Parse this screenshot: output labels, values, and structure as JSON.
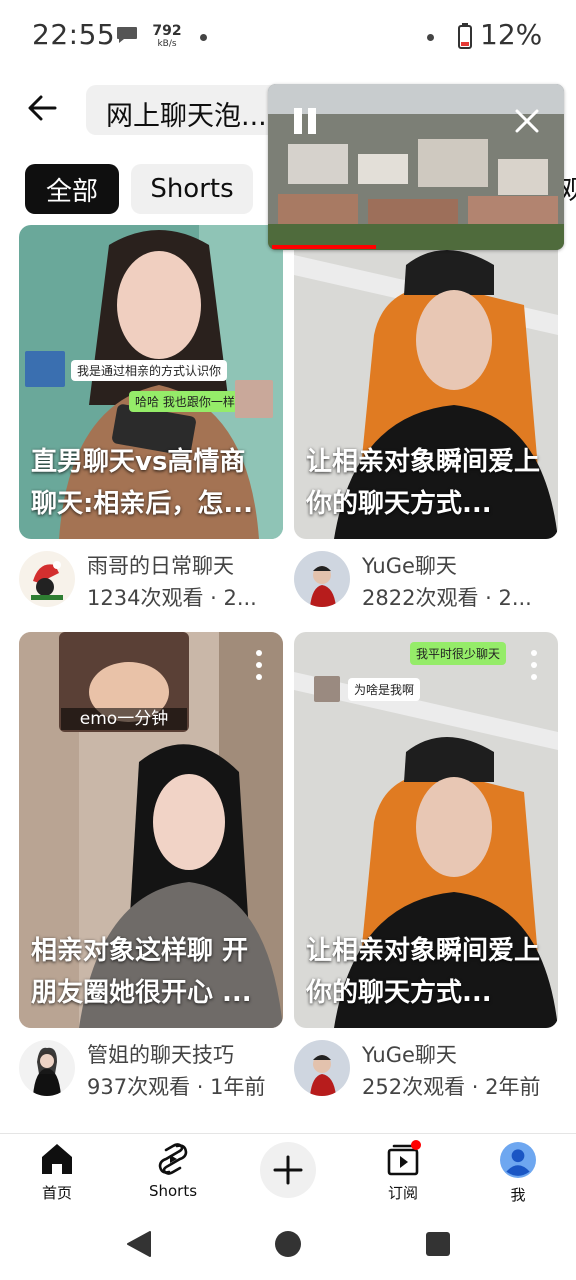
{
  "status_bar": {
    "time": "22:55",
    "net_speed_value": "792",
    "net_speed_unit": "kB/s",
    "battery_text": "12%",
    "battery_color": "#e53935"
  },
  "search": {
    "query": "网上聊天泡..."
  },
  "chips": {
    "all": "全部",
    "shorts": "Shorts",
    "edge_partial": "观"
  },
  "mini_player": {
    "progress": 0.36,
    "progress_color": "#ff0000"
  },
  "videos": [
    {
      "title": "直男聊天vs高情商聊天:相亲后，怎...",
      "overlay_chat_1": "我是通过相亲的方式认识你",
      "overlay_chat_2": "哈哈 我也跟你一样",
      "channel": "雨哥的日常聊天",
      "views": "1234次观看 · 2...",
      "avatar_icon": "santa-hat-avatar-icon"
    },
    {
      "title": "让相亲对象瞬间爱上你的聊天方式...",
      "channel": "YuGe聊天",
      "views": "2822次观看 · 2...",
      "avatar_icon": "man-avatar-icon"
    },
    {
      "title": "相亲对象这样聊 开朋友圈她很开心 ...",
      "overlay_caption": "emo一分钟",
      "channel": "管姐的聊天技巧",
      "views": "937次观看 · 1年前",
      "avatar_icon": "woman-avatar-icon"
    },
    {
      "title": "让相亲对象瞬间爱上你的聊天方式...",
      "overlay_chat_1": "我平时很少聊天",
      "overlay_chat_2": "为啥是我啊",
      "channel": "YuGe聊天",
      "views": "252次观看 · 2年前",
      "avatar_icon": "man-avatar-icon"
    }
  ],
  "bottom_nav": {
    "home": "首页",
    "shorts": "Shorts",
    "subscriptions": "订阅",
    "me": "我",
    "notification_dot_color": "#ff0000"
  }
}
